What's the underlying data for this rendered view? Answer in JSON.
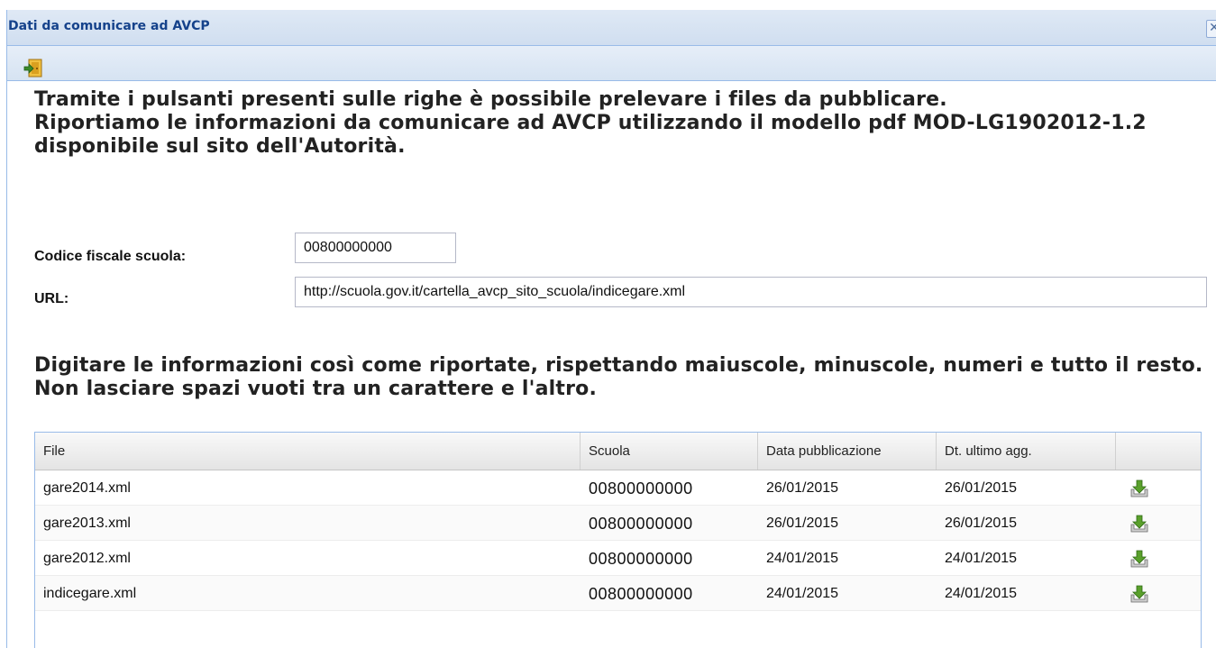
{
  "window": {
    "title": "Dati da comunicare ad AVCP",
    "close_icon": "close-icon"
  },
  "toolbar": {
    "exit_icon": "exit-door-icon"
  },
  "intro": {
    "line1": "Tramite i pulsanti presenti sulle righe è possibile prelevare i files da pubblicare.",
    "line2": "Riportiamo le informazioni da comunicare ad AVCP utilizzando il modello pdf MOD-LG1902012-1.2 disponibile sul sito dell'Autorità."
  },
  "form": {
    "codice_label": "Codice fiscale scuola:",
    "codice_value": "00800000000",
    "url_label": "URL:",
    "url_value": "http://scuola.gov.it/cartella_avcp_sito_scuola/indicegare.xml"
  },
  "instructions": {
    "line1": "Digitare le informazioni così come riportate, rispettando maiuscole, minuscole, numeri e tutto il resto.",
    "line2": "Non lasciare spazi vuoti tra un carattere e l'altro."
  },
  "grid": {
    "columns": [
      "File",
      "Scuola",
      "Data pubblicazione",
      "Dt. ultimo agg.",
      ""
    ],
    "rows": [
      {
        "file": "gare2014.xml",
        "scuola": "00800000000",
        "data_pubblicazione": "26/01/2015",
        "ultimo_agg": "26/01/2015",
        "action_icon": "download-icon"
      },
      {
        "file": "gare2013.xml",
        "scuola": "00800000000",
        "data_pubblicazione": "26/01/2015",
        "ultimo_agg": "26/01/2015",
        "action_icon": "download-icon"
      },
      {
        "file": "gare2012.xml",
        "scuola": "00800000000",
        "data_pubblicazione": "24/01/2015",
        "ultimo_agg": "24/01/2015",
        "action_icon": "download-icon"
      },
      {
        "file": "indicegare.xml",
        "scuola": "00800000000",
        "data_pubblicazione": "24/01/2015",
        "ultimo_agg": "24/01/2015",
        "action_icon": "download-icon"
      }
    ]
  },
  "colors": {
    "title_text": "#15428b",
    "border": "#99bbe8",
    "download_green": "#5aa02c"
  }
}
